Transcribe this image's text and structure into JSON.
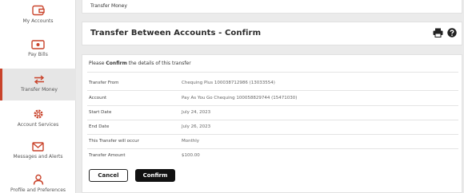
{
  "sidebar": {
    "items": [
      {
        "label": "My Accounts",
        "icon": "wallet-icon",
        "active": false
      },
      {
        "label": "Pay Bills",
        "icon": "money-icon",
        "active": false
      },
      {
        "label": "Transfer Money",
        "icon": "transfer-icon",
        "active": true
      },
      {
        "label": "Account Services",
        "icon": "gear-icon",
        "active": false
      },
      {
        "label": "Messages and Alerts",
        "icon": "envelope-icon",
        "active": false
      },
      {
        "label": "Profile and Preferences",
        "icon": "person-icon",
        "active": false
      }
    ],
    "accent_color": "#c9432b"
  },
  "breadcrumb": {
    "current": "Transfer Money"
  },
  "header": {
    "title": "Transfer Between Accounts - Confirm",
    "tools": [
      "print-icon",
      "help-icon"
    ]
  },
  "confirm": {
    "intro_prefix": "Please ",
    "intro_bold": "Confirm",
    "intro_suffix": " the details of this transfer",
    "rows": [
      {
        "label": "Transfer From",
        "value": "Chequing Plus 100038712986 (13033554)"
      },
      {
        "label": "Account",
        "value": "Pay As You Go Chequing 100058829744 (15471030)"
      },
      {
        "label": "Start Date",
        "value": "July 24, 2023"
      },
      {
        "label": "End Date",
        "value": "July 26, 2023"
      },
      {
        "label": "This Transfer will occur",
        "value": "Monthly"
      },
      {
        "label": "Transfer Amount",
        "value": "$100.00"
      }
    ],
    "cancel_label": "Cancel",
    "confirm_label": "Confirm"
  }
}
